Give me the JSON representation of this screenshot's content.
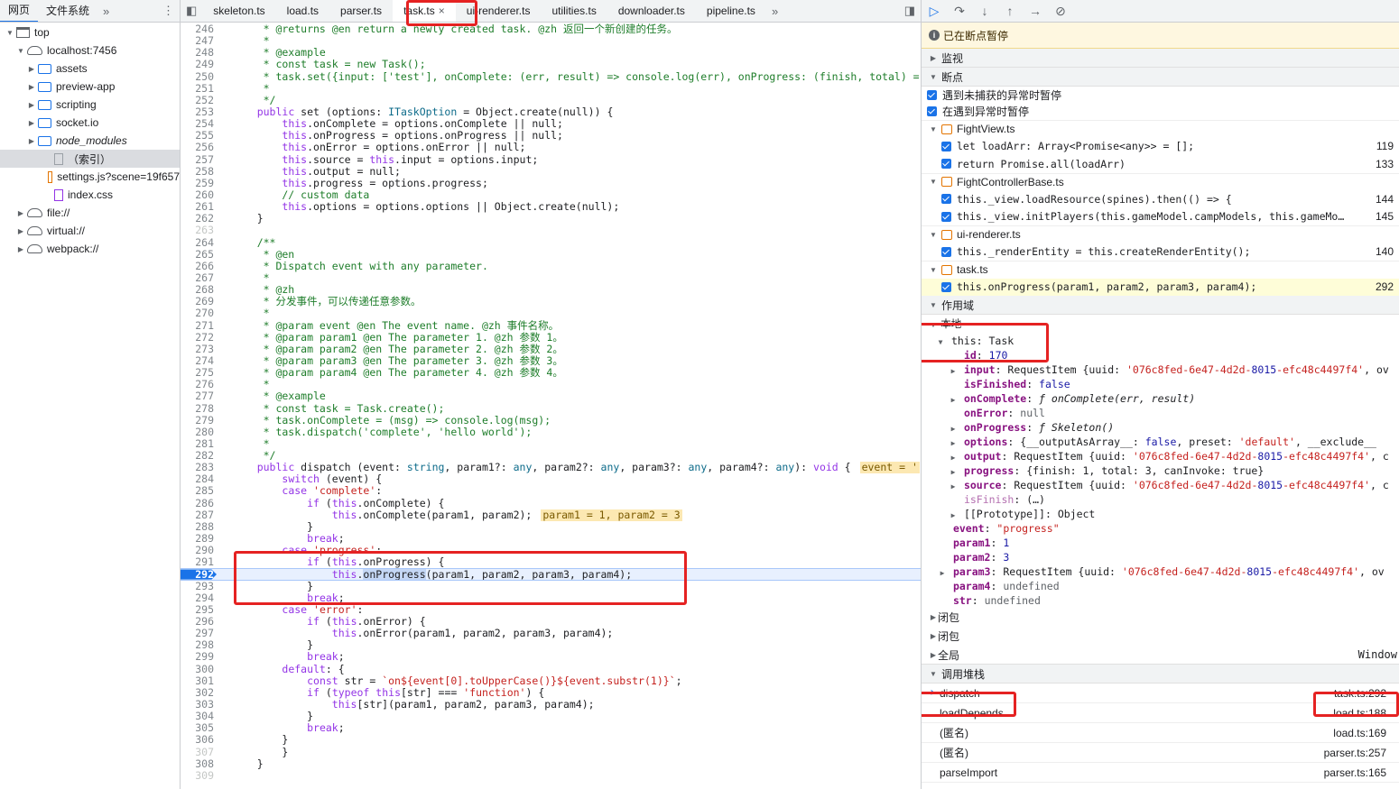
{
  "left": {
    "tabs": [
      "网页",
      "文件系统"
    ],
    "more": "»",
    "menu": "⋮",
    "tree": [
      {
        "label": "top",
        "level": 0,
        "icon": "frame",
        "expanded": true
      },
      {
        "label": "localhost:7456",
        "level": 1,
        "icon": "cloud",
        "expanded": true
      },
      {
        "label": "assets",
        "level": 2,
        "icon": "folder",
        "expanded": false
      },
      {
        "label": "preview-app",
        "level": 2,
        "icon": "folder",
        "expanded": false
      },
      {
        "label": "scripting",
        "level": 2,
        "icon": "folder",
        "expanded": false
      },
      {
        "label": "socket.io",
        "level": 2,
        "icon": "folder",
        "expanded": false
      },
      {
        "label": "node_modules",
        "level": 2,
        "icon": "folder",
        "expanded": false,
        "italic": true
      },
      {
        "label": "（索引）",
        "level": 3,
        "icon": "file",
        "selected": true
      },
      {
        "label": "settings.js?scene=19f657",
        "level": 3,
        "icon": "file-orange"
      },
      {
        "label": "index.css",
        "level": 3,
        "icon": "file-purple"
      },
      {
        "label": "file://",
        "level": 0,
        "icon": "cloud",
        "expanded": false,
        "indent1": true
      },
      {
        "label": "virtual://",
        "level": 0,
        "icon": "cloud",
        "expanded": false,
        "indent1": true
      },
      {
        "label": "webpack://",
        "level": 0,
        "icon": "cloud",
        "expanded": false,
        "indent1": true
      }
    ]
  },
  "editor": {
    "toggle_icon": "sidebar-toggle-icon",
    "tabs": [
      {
        "label": "skeleton.ts",
        "active": false
      },
      {
        "label": "load.ts",
        "active": false
      },
      {
        "label": "parser.ts",
        "active": false
      },
      {
        "label": "task.ts",
        "active": true,
        "closable": true
      },
      {
        "label": "ui-renderer.ts",
        "active": false
      },
      {
        "label": "utilities.ts",
        "active": false
      },
      {
        "label": "downloader.ts",
        "active": false
      },
      {
        "label": "pipeline.ts",
        "active": false
      }
    ],
    "more": "»",
    "current_line": 292,
    "lines": [
      {
        "n": 246,
        "t": "     * @returns @en return a newly created task. @zh 返回一个新创建的任务。",
        "c": "cmt"
      },
      {
        "n": 247,
        "t": "     *",
        "c": "cmt"
      },
      {
        "n": 248,
        "t": "     * @example",
        "c": "cmt"
      },
      {
        "n": 249,
        "t": "     * const task = new Task();",
        "c": "cmt"
      },
      {
        "n": 250,
        "t": "     * task.set({input: ['test'], onComplete: (err, result) => console.log(err), onProgress: (finish, total) =",
        "c": "cmt"
      },
      {
        "n": 251,
        "t": "     *",
        "c": "cmt"
      },
      {
        "n": 252,
        "t": "     */",
        "c": "cmt"
      },
      {
        "n": 253,
        "t": "    public set (options: ITaskOption = Object.create(null)) {"
      },
      {
        "n": 254,
        "t": "        this.onComplete = options.onComplete || null;"
      },
      {
        "n": 255,
        "t": "        this.onProgress = options.onProgress || null;"
      },
      {
        "n": 256,
        "t": "        this.onError = options.onError || null;"
      },
      {
        "n": 257,
        "t": "        this.source = this.input = options.input;"
      },
      {
        "n": 258,
        "t": "        this.output = null;"
      },
      {
        "n": 259,
        "t": "        this.progress = options.progress;"
      },
      {
        "n": 260,
        "t": "        // custom data",
        "c": "cmt"
      },
      {
        "n": 261,
        "t": "        this.options = options.options || Object.create(null);"
      },
      {
        "n": 262,
        "t": "    }"
      },
      {
        "n": 263,
        "t": "",
        "gray": true
      },
      {
        "n": 264,
        "t": "    /**",
        "c": "cmt"
      },
      {
        "n": 265,
        "t": "     * @en",
        "c": "cmt"
      },
      {
        "n": 266,
        "t": "     * Dispatch event with any parameter.",
        "c": "cmt"
      },
      {
        "n": 267,
        "t": "     *",
        "c": "cmt"
      },
      {
        "n": 268,
        "t": "     * @zh",
        "c": "cmt"
      },
      {
        "n": 269,
        "t": "     * 分发事件，可以传递任意参数。",
        "c": "cmt"
      },
      {
        "n": 270,
        "t": "     *",
        "c": "cmt"
      },
      {
        "n": 271,
        "t": "     * @param event @en The event name. @zh 事件名称。",
        "c": "cmt"
      },
      {
        "n": 272,
        "t": "     * @param param1 @en The parameter 1. @zh 参数 1。",
        "c": "cmt"
      },
      {
        "n": 273,
        "t": "     * @param param2 @en The parameter 2. @zh 参数 2。",
        "c": "cmt"
      },
      {
        "n": 274,
        "t": "     * @param param3 @en The parameter 3. @zh 参数 3。",
        "c": "cmt"
      },
      {
        "n": 275,
        "t": "     * @param param4 @en The parameter 4. @zh 参数 4。",
        "c": "cmt"
      },
      {
        "n": 276,
        "t": "     *",
        "c": "cmt"
      },
      {
        "n": 277,
        "t": "     * @example",
        "c": "cmt"
      },
      {
        "n": 278,
        "t": "     * const task = Task.create();",
        "c": "cmt"
      },
      {
        "n": 279,
        "t": "     * task.onComplete = (msg) => console.log(msg);",
        "c": "cmt"
      },
      {
        "n": 280,
        "t": "     * task.dispatch('complete', 'hello world');",
        "c": "cmt"
      },
      {
        "n": 281,
        "t": "     *",
        "c": "cmt"
      },
      {
        "n": 282,
        "t": "     */",
        "c": "cmt"
      },
      {
        "n": 283,
        "t": "    public dispatch (event: string, param1?: any, param2?: any, param3?: any, param4?: any): void {",
        "inline": "event = '"
      },
      {
        "n": 284,
        "t": "        switch (event) {"
      },
      {
        "n": 285,
        "t": "        case 'complete':"
      },
      {
        "n": 286,
        "t": "            if (this.onComplete) {"
      },
      {
        "n": 287,
        "t": "                this.onComplete(param1, param2);",
        "inline": "param1 = 1, param2 = 3"
      },
      {
        "n": 288,
        "t": "            }"
      },
      {
        "n": 289,
        "t": "            break;"
      },
      {
        "n": 290,
        "t": "        case 'progress':"
      },
      {
        "n": 291,
        "t": "            if (this.onProgress) {"
      },
      {
        "n": 292,
        "t": "                this.onProgress(param1, param2, param3, param4);",
        "current": true
      },
      {
        "n": 293,
        "t": "            }"
      },
      {
        "n": 294,
        "t": "            break;"
      },
      {
        "n": 295,
        "t": "        case 'error':"
      },
      {
        "n": 296,
        "t": "            if (this.onError) {"
      },
      {
        "n": 297,
        "t": "                this.onError(param1, param2, param3, param4);"
      },
      {
        "n": 298,
        "t": "            }"
      },
      {
        "n": 299,
        "t": "            break;"
      },
      {
        "n": 300,
        "t": "        default: {"
      },
      {
        "n": 301,
        "t": "            const str = `on${event[0].toUpperCase()}${event.substr(1)}`;"
      },
      {
        "n": 302,
        "t": "            if (typeof this[str] === 'function') {"
      },
      {
        "n": 303,
        "t": "                this[str](param1, param2, param3, param4);"
      },
      {
        "n": 304,
        "t": "            }"
      },
      {
        "n": 305,
        "t": "            break;"
      },
      {
        "n": 306,
        "t": "        }"
      },
      {
        "n": 307,
        "t": "        }",
        "gray": true
      },
      {
        "n": 308,
        "t": "    }"
      },
      {
        "n": 309,
        "t": "",
        "gray": true
      }
    ]
  },
  "debugger": {
    "controls": [
      "resume-icon",
      "step-over-icon",
      "step-into-icon",
      "step-out-icon",
      "step-icon",
      "deactivate-breakpoints-icon"
    ],
    "paused_text": "已在断点暂停",
    "sections": {
      "watch": "监视",
      "breakpoints": "断点",
      "scope": "作用域",
      "callstack": "调用堆栈"
    },
    "exception_options": [
      "遇到未捕获的异常时暂停",
      "在遇到异常时暂停"
    ],
    "breakpoint_files": [
      {
        "file": "FightView.ts",
        "items": [
          {
            "code": "let loadArr: Array<Promise<any>> = [];",
            "line": "119"
          },
          {
            "code": "return Promise.all(loadArr)",
            "line": "133"
          }
        ]
      },
      {
        "file": "FightControllerBase.ts",
        "items": [
          {
            "code": "this._view.loadResource(spines).then(() => {",
            "line": "144"
          },
          {
            "code": "this._view.initPlayers(this.gameModel.campModels, this.gameMo…",
            "line": "145"
          }
        ]
      },
      {
        "file": "ui-renderer.ts",
        "items": [
          {
            "code": "this._renderEntity = this.createRenderEntity();",
            "line": "140"
          }
        ]
      },
      {
        "file": "task.ts",
        "items": [
          {
            "code": "this.onProgress(param1, param2, param3, param4);",
            "line": "292",
            "current": true
          }
        ]
      }
    ],
    "scope": {
      "local_label": "本地",
      "this_label": "this",
      "this_type": "Task",
      "rows": [
        {
          "indent": 2,
          "name": "id",
          "val": "170",
          "vc": "vn",
          "exp": false
        },
        {
          "indent": 2,
          "name": "input",
          "val": "RequestItem {uuid: '076c8fed-6e47-4d2d-8015-efc48c4497f4', ov",
          "exp": true,
          "strpart": true
        },
        {
          "indent": 2,
          "name": "isFinished",
          "val": "false",
          "vc": "vk"
        },
        {
          "indent": 2,
          "name": "onComplete",
          "val": "ƒ onComplete(err, result)",
          "vc": "it",
          "exp": true
        },
        {
          "indent": 2,
          "name": "onError",
          "val": "null",
          "vc": "vg"
        },
        {
          "indent": 2,
          "name": "onProgress",
          "val": "ƒ Skeleton()",
          "vc": "it",
          "exp": true
        },
        {
          "indent": 2,
          "name": "options",
          "val": "{__outputAsArray__: false, preset: 'default', __exclude__",
          "exp": true
        },
        {
          "indent": 2,
          "name": "output",
          "val": "RequestItem {uuid: '076c8fed-6e47-4d2d-8015-efc48c4497f4', c",
          "exp": true
        },
        {
          "indent": 2,
          "name": "progress",
          "val": "{finish: 1, total: 3, canInvoke: true}",
          "exp": true
        },
        {
          "indent": 2,
          "name": "source",
          "val": "RequestItem {uuid: '076c8fed-6e47-4d2d-8015-efc48c4497f4', c",
          "exp": true
        },
        {
          "indent": 2,
          "name": "isFinish",
          "val": "(…)",
          "dim": true
        },
        {
          "indent": 2,
          "name": "[[Prototype]]",
          "val": "Object",
          "exp": true,
          "plain": true
        },
        {
          "indent": 1,
          "name": "event",
          "val": "\"progress\"",
          "vc": "vs"
        },
        {
          "indent": 1,
          "name": "param1",
          "val": "1",
          "vc": "vn"
        },
        {
          "indent": 1,
          "name": "param2",
          "val": "3",
          "vc": "vn"
        },
        {
          "indent": 1,
          "name": "param3",
          "val": "RequestItem {uuid: '076c8fed-6e47-4d2d-8015-efc48c4497f4', ov",
          "exp": true
        },
        {
          "indent": 1,
          "name": "param4",
          "val": "undefined",
          "vc": "vg"
        },
        {
          "indent": 1,
          "name": "str",
          "val": "undefined",
          "vc": "vg"
        }
      ],
      "closures": [
        "闭包",
        "闭包"
      ],
      "global_label": "全局",
      "global_value": "Window"
    },
    "callstack": [
      {
        "name": "dispatch",
        "loc": "task.ts:292",
        "current": true
      },
      {
        "name": "loadDepends",
        "loc": "load.ts:188"
      },
      {
        "name": "(匿名)",
        "loc": "load.ts:169"
      },
      {
        "name": "(匿名)",
        "loc": "parser.ts:257"
      },
      {
        "name": "parseImport",
        "loc": "parser.ts:165"
      }
    ]
  },
  "colors": {
    "accent": "#1a73e8",
    "highlight_box": "#e52222"
  }
}
